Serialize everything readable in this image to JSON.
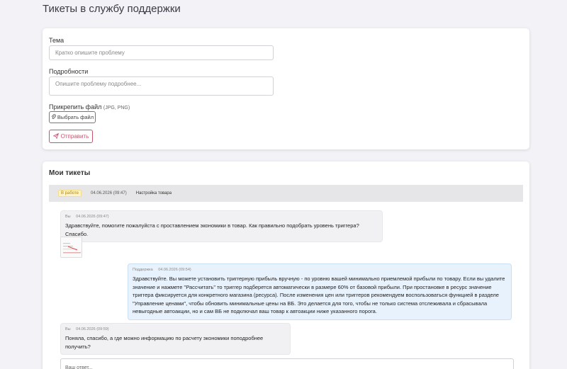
{
  "page": {
    "title": "Тикеты в службу поддержки"
  },
  "form": {
    "subject_label": "Тема",
    "subject_placeholder": "Кратко опишите проблему",
    "details_label": "Подробности",
    "details_placeholder": "Опишите проблему подробнее...",
    "attach_label": "Прикрепить файл",
    "attach_hint": "(JPG, PNG)",
    "choose_file_label": "Выбрать файл",
    "submit_label": "Отправить"
  },
  "tickets": {
    "title": "Мои тикеты",
    "ticket": {
      "status": "В работе",
      "date": "04.06.2026 (09:47)",
      "subject": "Настройка товара",
      "messages": [
        {
          "author": "Вы",
          "date": "04.06.2026 (09:47)",
          "text": "Здравствуйте, помогите пожалуйста с проставлением экономики в товар. Как правильно подобрать уровень триггера? Спасибо."
        },
        {
          "author": "Поддержка",
          "date": "04.06.2026 (09:54)",
          "text": "Здравствуйте. Вы можете установить триггерную прибыль вручную - по уровню вашей минимально приемлемой прибыли по товару. Если вы удалите значение и нажмете \"Рассчитать\" то триггер подберется автоматически в размере 60% от базовой прибыли. При простановке в ресурс значение триггера фиксируется для конкретного магазина (ресурса). После изменения цен или триггеров рекомендуем воспользоваться функцией в разделе \"Управление ценами\", чтобы обновить минимальные цены на ВБ. Это делается для того, чтобы не только система отслеживала и сбрасывала невыгодные автоакции, но и сам ВБ не подключал ваш товар к автоакции ниже указанного порога."
        },
        {
          "author": "Вы",
          "date": "04.06.2026 (09:59)",
          "text": "Поняла, спасибо, а где можно информацию по расчету экономики поподробнее получить?"
        }
      ]
    },
    "reply_placeholder": "Ваш ответ..."
  },
  "colors": {
    "accent": "#c7546c",
    "badge_bg": "#fff3cd",
    "support_bubble": "#e8f2fc"
  }
}
